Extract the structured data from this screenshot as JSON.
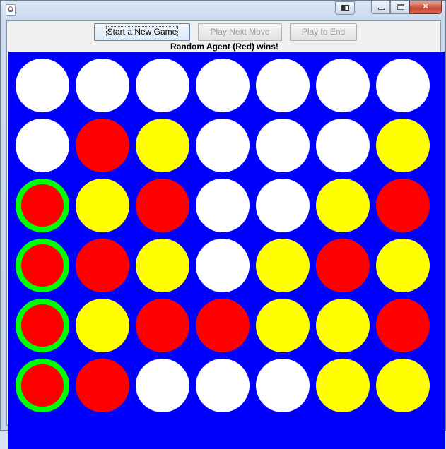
{
  "window": {
    "title": "",
    "controls": [
      "window-switch-icon",
      "minimize-icon",
      "maximize-icon",
      "close-icon"
    ]
  },
  "toolbar": {
    "new_game_label": "Start a New Game",
    "play_next_label": "Play Next Move",
    "play_to_end_label": "Play to End"
  },
  "status": {
    "message": "Random Agent (Red) wins!"
  },
  "colors": {
    "board": "#0000ff",
    "red": "#ff0000",
    "yellow": "#ffff00",
    "empty": "#ffffff",
    "highlight": "#00ff00"
  },
  "board": {
    "columns": 7,
    "rows": [
      [
        "empty",
        "empty",
        "empty",
        "empty",
        "empty",
        "empty",
        "empty"
      ],
      [
        "empty",
        "red",
        "yellow",
        "empty",
        "empty",
        "empty",
        "yellow"
      ],
      [
        "red",
        "yellow",
        "red",
        "empty",
        "empty",
        "yellow",
        "red"
      ],
      [
        "red",
        "red",
        "yellow",
        "empty",
        "yellow",
        "red",
        "yellow"
      ],
      [
        "red",
        "yellow",
        "red",
        "red",
        "yellow",
        "yellow",
        "red"
      ],
      [
        "red",
        "red",
        "empty",
        "empty",
        "empty",
        "yellow",
        "yellow"
      ]
    ],
    "winning_cells": [
      [
        2,
        0
      ],
      [
        3,
        0
      ],
      [
        4,
        0
      ],
      [
        5,
        0
      ]
    ]
  }
}
